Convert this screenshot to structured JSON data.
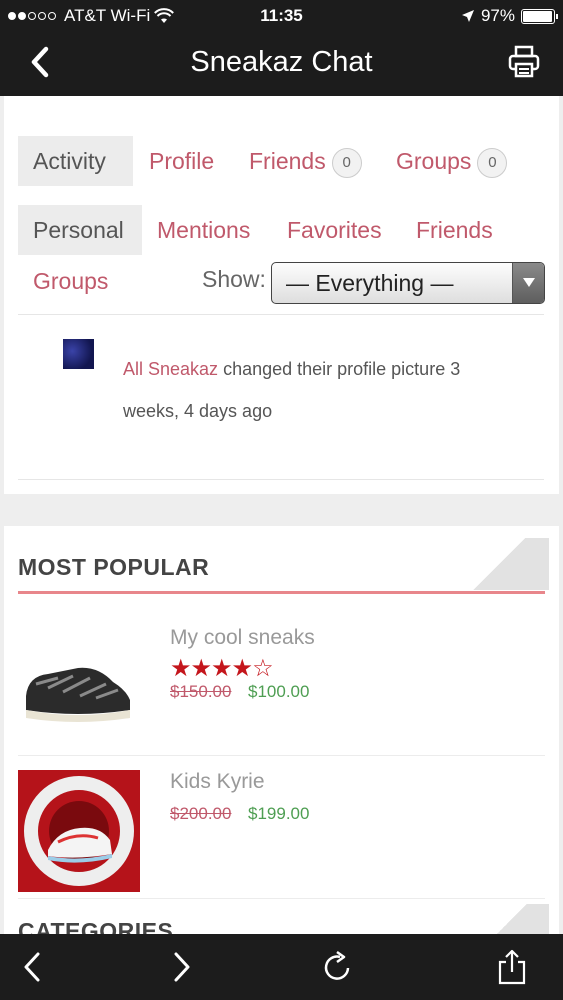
{
  "status_bar": {
    "carrier": "AT&T Wi-Fi",
    "time": "11:35",
    "battery": "97%",
    "battery_level": 0.97
  },
  "nav_bar": {
    "title": "Sneakaz Chat",
    "back_icon": "chevron-left-icon",
    "print_icon": "printer-icon"
  },
  "activity": {
    "tabs": [
      {
        "label": "Activity",
        "active": true
      },
      {
        "label": "Profile"
      },
      {
        "label": "Friends",
        "count": "0"
      },
      {
        "label": "Groups",
        "count": "0"
      }
    ],
    "subtabs": [
      {
        "label": "Personal",
        "active": true
      },
      {
        "label": "Mentions"
      },
      {
        "label": "Favorites"
      },
      {
        "label": "Friends"
      },
      {
        "label": "Groups"
      }
    ],
    "show_label": "Show:",
    "show_selected": "— Everything —",
    "feed": [
      {
        "user": "All Sneakaz",
        "text": " changed their profile picture 3 weeks, 4 days ago"
      }
    ]
  },
  "most_popular": {
    "title": "MOST POPULAR",
    "products": [
      {
        "name": "My cool sneaks",
        "rating": 4,
        "rating_max": 5,
        "old_price": "$150.00",
        "new_price": "$100.00"
      },
      {
        "name": "Kids Kyrie",
        "old_price": "$200.00",
        "new_price": "$199.00"
      }
    ]
  },
  "categories": {
    "title": "CATEGORIES"
  },
  "toolbar": {
    "icons": [
      "back-arrow-icon",
      "forward-arrow-icon",
      "reload-icon",
      "share-icon"
    ]
  },
  "colors": {
    "bar_bg": "#1c1c1c",
    "link": "#c0596b",
    "accent_rule": "#e8868b",
    "sale_price": "#4e9e52",
    "star": "#c4161c"
  }
}
